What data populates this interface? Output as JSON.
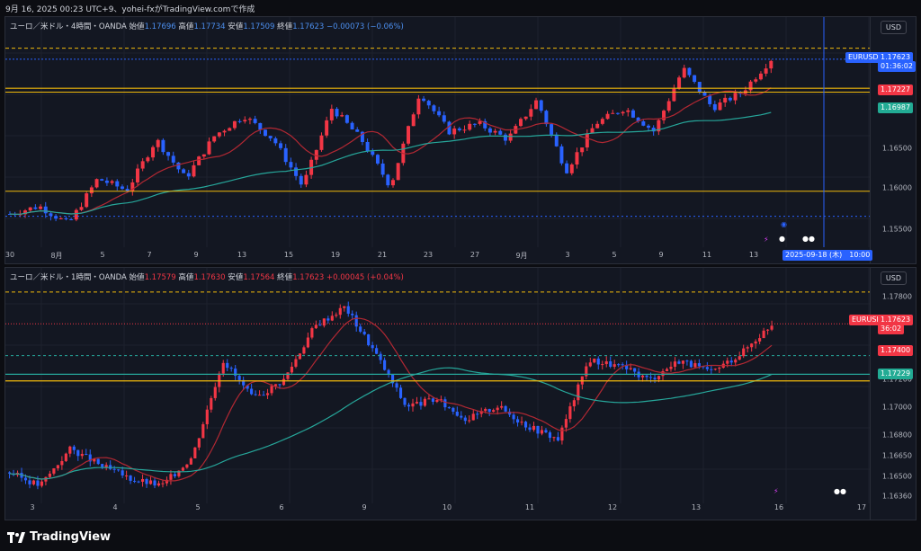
{
  "header": {
    "text": "9月 16, 2025 00:23 UTC+9、yohei-fxがTradingView.comで作成"
  },
  "colors": {
    "bg": "#131722",
    "up": "#f23645",
    "down": "#2962ff",
    "ma_fast": "#b22833",
    "ma_slow": "#26a69a",
    "level": "#f0b90b",
    "blue_tag": "#2962ff",
    "red_tag": "#f23645"
  },
  "panel1": {
    "legend": {
      "symbol": "ユーロ／米ドル・4時間・OANDA",
      "open_label": "始値",
      "open": "1.17696",
      "high_label": "高値",
      "high": "1.17734",
      "low_label": "安値",
      "low": "1.17509",
      "close_label": "終値",
      "close": "1.17623",
      "change": "−0.00073 (−0.06%)"
    },
    "currency": "USD",
    "yticks": [
      "1.16500",
      "1.16000",
      "1.15500"
    ],
    "xticks": [
      "30",
      "8月",
      "5",
      "7",
      "9",
      "13",
      "15",
      "19",
      "21",
      "23",
      "27",
      "9月",
      "3",
      "5",
      "9",
      "11",
      "13"
    ],
    "tags": {
      "symbol": "EURUSD",
      "price": "1.17623",
      "countdown": "01:36:02",
      "level1": "1.17227",
      "level2": "1.16987"
    },
    "crosshair_date": "2025-09-18 (木)　10:00",
    "ylim": [
      1.1525,
      1.1795
    ]
  },
  "panel2": {
    "legend": {
      "symbol": "ユーロ／米ドル・1時間・OANDA",
      "open_label": "始値",
      "open": "1.17579",
      "high_label": "高値",
      "high": "1.17630",
      "low_label": "安値",
      "low": "1.17564",
      "close_label": "終値",
      "close": "1.17623",
      "change": "+0.00045 (+0.04%)"
    },
    "currency": "USD",
    "yticks": [
      "1.17800",
      "1.17200",
      "1.17000",
      "1.16800",
      "1.16650",
      "1.16500",
      "1.16360"
    ],
    "xticks": [
      "3",
      "4",
      "5",
      "6",
      "9",
      "10",
      "11",
      "12",
      "13",
      "16",
      "17"
    ],
    "tags": {
      "symbol": "EURUSD",
      "price": "1.17623",
      "countdown": "36:02",
      "level1": "1.17400",
      "level2": "1.17229"
    },
    "ylim": [
      1.1628,
      1.1792
    ]
  },
  "footer": {
    "brand": "TradingView"
  }
}
